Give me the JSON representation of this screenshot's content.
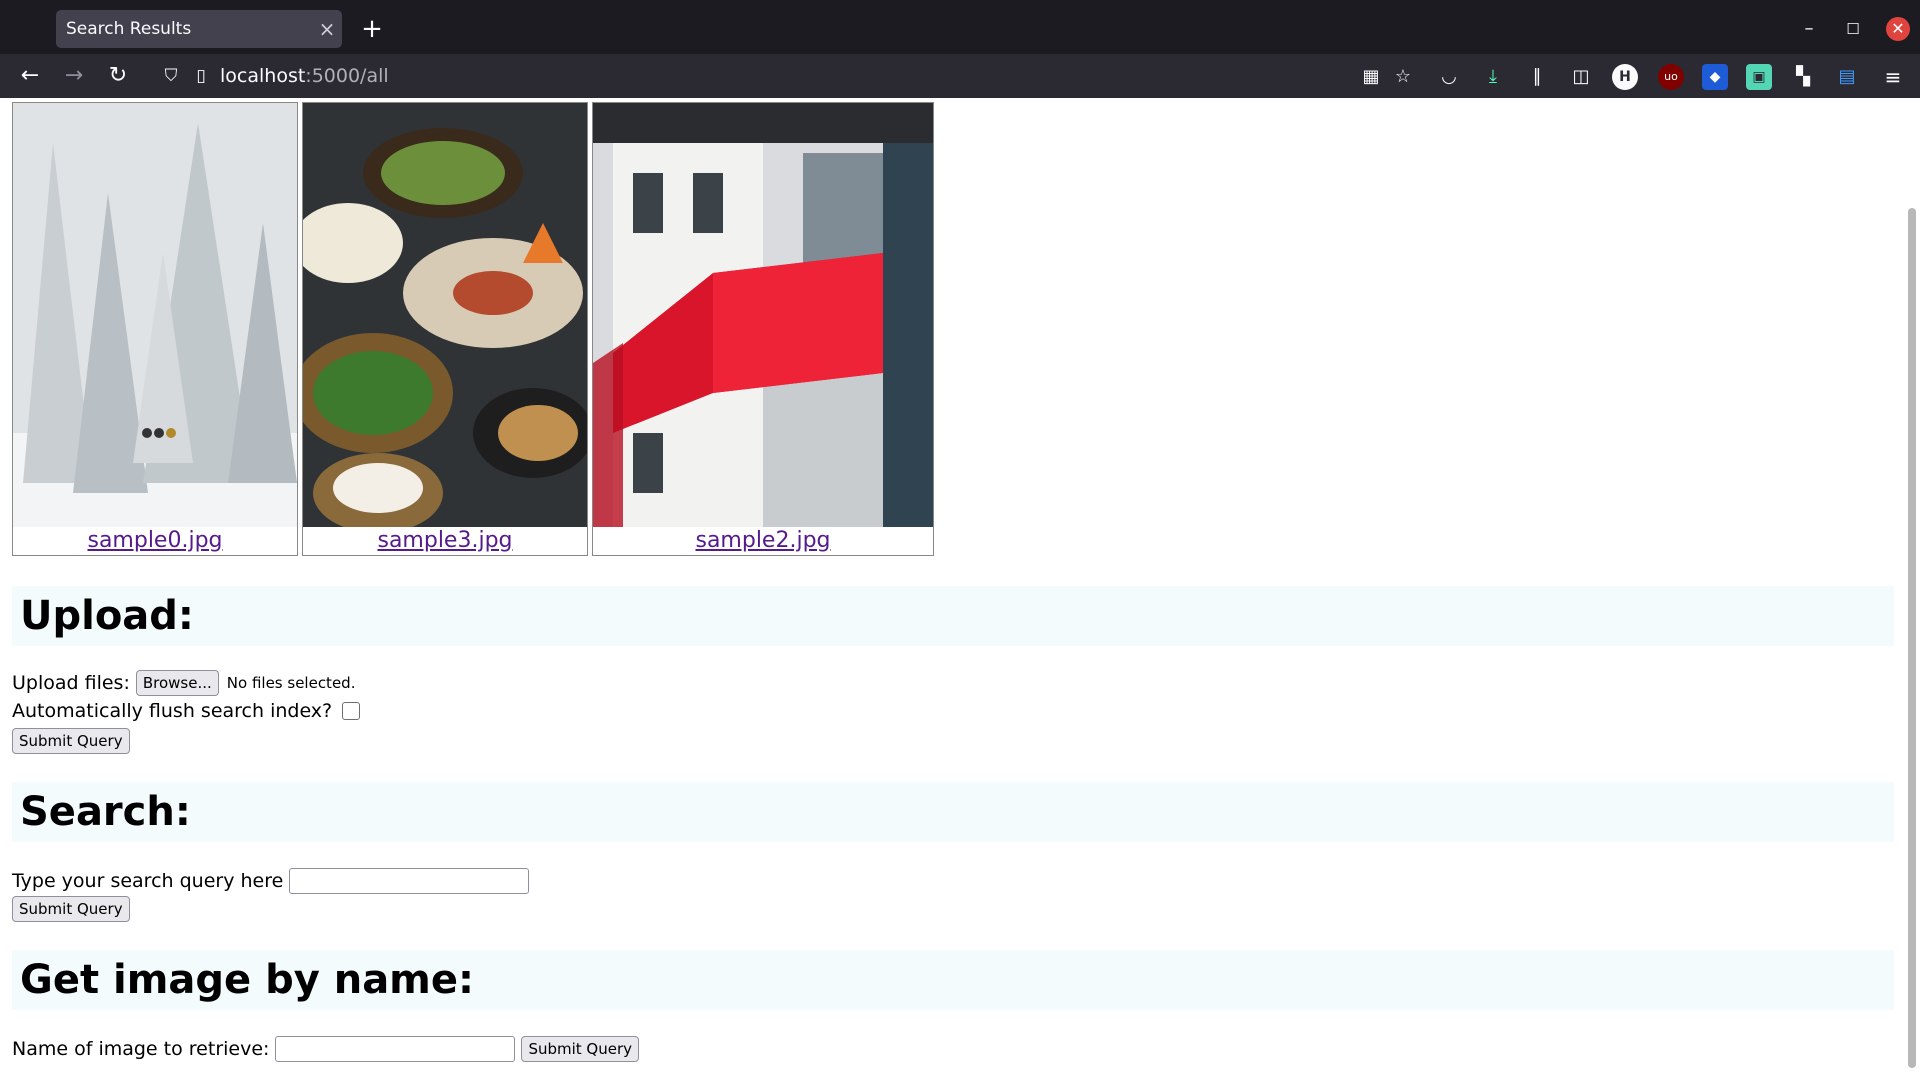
{
  "browser": {
    "tab_title": "Search Results",
    "url_host": "localhost",
    "url_path": ":5000/all"
  },
  "gallery": [
    {
      "caption": "sample0.jpg",
      "scene": "snowy forest"
    },
    {
      "caption": "sample3.jpg",
      "scene": "food bowls"
    },
    {
      "caption": "sample2.jpg",
      "scene": "red bridge building"
    }
  ],
  "upload": {
    "heading": "Upload:",
    "files_label": "Upload files:",
    "browse_label": "Browse...",
    "no_files": "No files selected.",
    "flush_label": "Automatically flush search index?",
    "flush_checked": false,
    "submit_label": "Submit Query"
  },
  "search": {
    "heading": "Search:",
    "query_label": "Type your search query here",
    "query_value": "",
    "submit_label": "Submit Query"
  },
  "get_by_name": {
    "heading": "Get image by name:",
    "name_label": "Name of image to retrieve:",
    "name_value": "",
    "submit_label": "Submit Query"
  },
  "colors": {
    "link": "#551a8b",
    "section_bg": "#f4fbfd",
    "chrome_dark": "#1c1b22"
  }
}
